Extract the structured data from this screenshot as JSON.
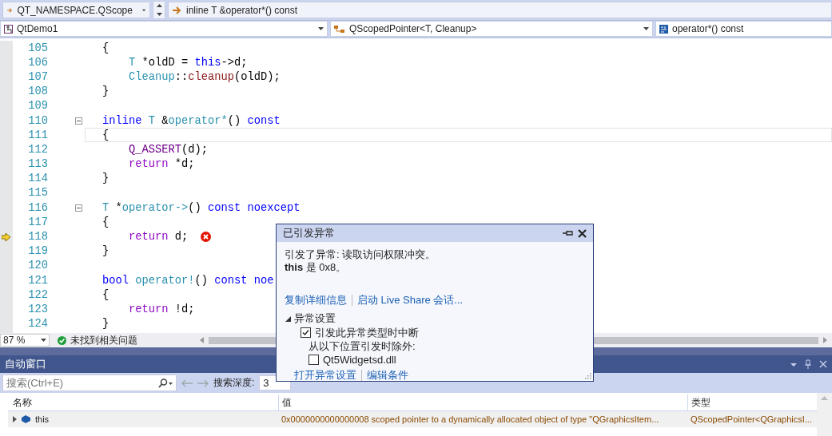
{
  "nav_bar": {
    "scope": "QT_NAMESPACE.QScope",
    "member": "inline T &operator*() const"
  },
  "context_bar": {
    "project": "QtDemo1",
    "class": "QScopedPointer<T, Cleanup>",
    "function": "operator*() const"
  },
  "editor": {
    "lines": [
      {
        "number": "105",
        "current": false,
        "collapsible": false,
        "execution": false,
        "error": false,
        "tokens": [
          {
            "t": "{",
            "kind": "plain"
          }
        ],
        "children": [
          {
            "number": "106",
            "current": false,
            "collapsible": false,
            "execution": false,
            "error": false,
            "tokens": [
              {
                "t": "T",
                "kind": "type"
              },
              {
                "t": " *oldD = ",
                "kind": "plain"
              },
              {
                "t": "this",
                "kind": "keyword"
              },
              {
                "t": "->d;",
                "kind": "plain"
              }
            ]
          },
          {
            "number": "107",
            "current": false,
            "collapsible": false,
            "execution": false,
            "error": false,
            "tokens": [
              {
                "t": "Cleanup",
                "kind": "type"
              },
              {
                "t": "::",
                "kind": "plain"
              },
              {
                "t": "cleanup",
                "kind": "function"
              },
              {
                "t": "(oldD);",
                "kind": "plain"
              }
            ]
          }
        ]
      },
      {
        "number": "108",
        "current": false,
        "collapsible": false,
        "execution": false,
        "error": false,
        "tokens": [
          {
            "t": "}",
            "kind": "plain"
          }
        ]
      },
      {
        "number": "109",
        "current": false,
        "collapsible": false,
        "execution": false,
        "error": false
      },
      {
        "number": "110",
        "current": false,
        "collapsible": true,
        "execution": false,
        "error": false,
        "tokens": [
          {
            "t": "inline ",
            "kind": "keyword"
          },
          {
            "t": "T",
            "kind": "type"
          },
          {
            "t": " &",
            "kind": "plain"
          },
          {
            "t": "operator*",
            "kind": "type"
          },
          {
            "t": "() ",
            "kind": "plain"
          },
          {
            "t": "const",
            "kind": "keyword"
          }
        ]
      },
      {
        "number": "111",
        "current": true,
        "collapsible": false,
        "execution": false,
        "error": false,
        "tokens": [
          {
            "t": "{",
            "kind": "plain"
          }
        ],
        "children": [
          {
            "number": "112",
            "current": false,
            "collapsible": false,
            "execution": false,
            "error": false,
            "tokens": [
              {
                "t": "Q_ASSERT",
                "kind": "macro"
              },
              {
                "t": "(d);",
                "kind": "plain"
              }
            ]
          },
          {
            "number": "113",
            "current": false,
            "collapsible": false,
            "execution": false,
            "error": false,
            "tokens": [
              {
                "t": "return",
                "kind": "control"
              },
              {
                "t": " *d;",
                "kind": "plain"
              }
            ]
          }
        ]
      },
      {
        "number": "114",
        "current": false,
        "collapsible": false,
        "execution": false,
        "error": false,
        "tokens": [
          {
            "t": "}",
            "kind": "plain"
          }
        ]
      },
      {
        "number": "115",
        "current": false,
        "collapsible": false,
        "execution": false,
        "error": false
      },
      {
        "number": "116",
        "current": false,
        "collapsible": true,
        "execution": false,
        "error": false,
        "tokens": [
          {
            "t": "T",
            "kind": "type"
          },
          {
            "t": " *",
            "kind": "plain"
          },
          {
            "t": "operator->",
            "kind": "type"
          },
          {
            "t": "() ",
            "kind": "plain"
          },
          {
            "t": "const noexcept",
            "kind": "keyword"
          }
        ]
      },
      {
        "number": "117",
        "current": false,
        "collapsible": false,
        "execution": false,
        "error": false,
        "tokens": [
          {
            "t": "{",
            "kind": "plain"
          }
        ],
        "children": [
          {
            "number": "118",
            "current": false,
            "collapsible": false,
            "execution": true,
            "error": true,
            "tokens": [
              {
                "t": "return",
                "kind": "control"
              },
              {
                "t": " d;",
                "kind": "plain"
              }
            ]
          }
        ]
      },
      {
        "number": "119",
        "current": false,
        "collapsible": false,
        "execution": false,
        "error": false,
        "tokens": [
          {
            "t": "}",
            "kind": "plain"
          }
        ]
      },
      {
        "number": "120",
        "current": false,
        "collapsible": false,
        "execution": false,
        "error": false
      },
      {
        "number": "121",
        "current": false,
        "collapsible": false,
        "execution": false,
        "error": false,
        "tokens": [
          {
            "t": "bool ",
            "kind": "keyword"
          },
          {
            "t": "operator!",
            "kind": "type"
          },
          {
            "t": "() ",
            "kind": "plain"
          },
          {
            "t": "const noe",
            "kind": "keyword"
          }
        ]
      },
      {
        "number": "122",
        "current": false,
        "collapsible": false,
        "execution": false,
        "error": false,
        "tokens": [
          {
            "t": "{",
            "kind": "plain"
          }
        ],
        "children": [
          {
            "number": "123",
            "current": false,
            "collapsible": false,
            "execution": false,
            "error": false,
            "tokens": [
              {
                "t": "return",
                "kind": "control"
              },
              {
                "t": " !d;",
                "kind": "plain"
              }
            ]
          }
        ]
      },
      {
        "number": "124",
        "current": false,
        "collapsible": false,
        "execution": false,
        "error": false,
        "tokens": [
          {
            "t": "}",
            "kind": "plain"
          }
        ]
      }
    ]
  },
  "status": {
    "zoom": "87 %",
    "issues": "未找到相关问题"
  },
  "autos_window": {
    "title": "自动窗口",
    "search": {
      "placeholder": "搜索(Ctrl+E)"
    },
    "depth_label": "搜索深度:",
    "depth": "3",
    "columns": [
      "名称",
      "值",
      "类型"
    ],
    "rows": [
      {
        "name": "this",
        "value": "0x0000000000000008 scoped pointer to a dynamically allocated object of type \"QGraphicsItem...",
        "type": "QScopedPointer<QGraphicsI..."
      }
    ]
  },
  "exception_popup": {
    "title": "已引发异常",
    "message": [
      "引发了异常: 读取访问权限冲突。",
      "**this** 是 0x8。"
    ],
    "links": [
      "复制详细信息",
      "启动 Live Share 会话..."
    ],
    "settings": {
      "label": "异常设置",
      "expanded": true,
      "break_option": {
        "label": "引发此异常类型时中断",
        "checked": true
      },
      "except_label": "从以下位置引发时除外:",
      "modules": [
        {
          "label": "Qt5Widgetsd.dll",
          "checked": false
        }
      ]
    },
    "footer_links": [
      "打开异常设置",
      "编辑条件"
    ]
  }
}
